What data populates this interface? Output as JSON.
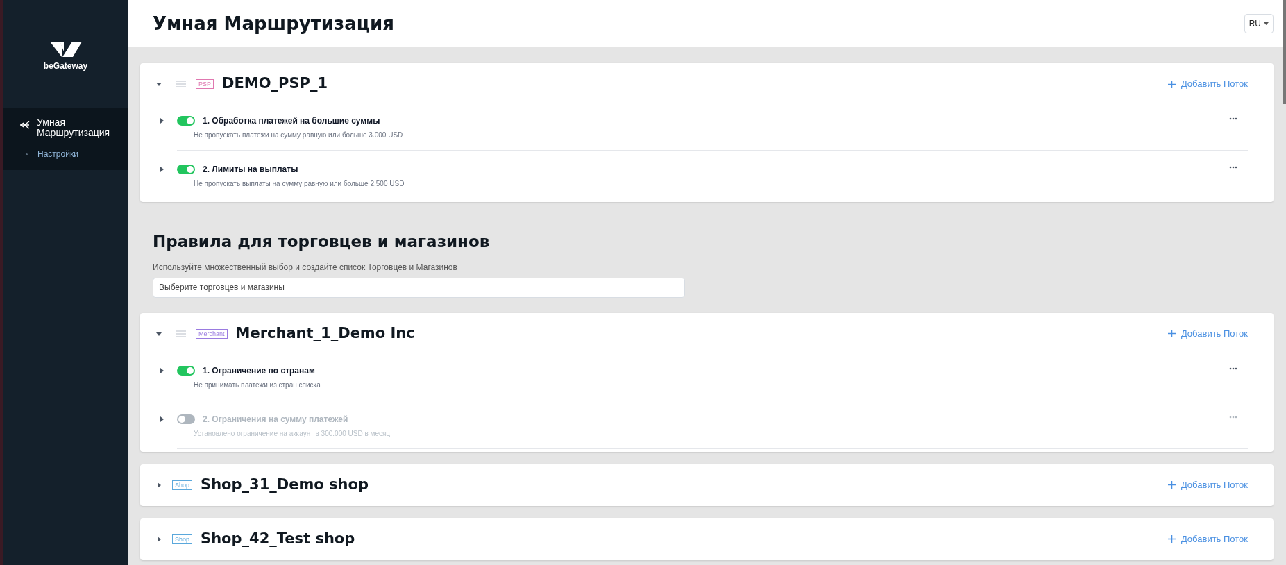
{
  "sidebar": {
    "logo_text": "beGateway",
    "items": [
      {
        "label": "Умная Маршрутизация",
        "selected": true,
        "children": [
          {
            "label": "Настройки",
            "selected": false
          }
        ]
      }
    ]
  },
  "header": {
    "title": "Умная Маршрутизация",
    "language": "RU"
  },
  "groups_top": [
    {
      "tag": "PSP",
      "color": "#e078b0",
      "title": "DEMO_PSP_1",
      "expanded": true,
      "add_label": "Добавить Поток",
      "rules": [
        {
          "title": "1. Обработка платежей на большие суммы",
          "description": "Не пропускать платежи на сумму равную или больше 3.000 USD",
          "on": true
        },
        {
          "title": "2. Лимиты на выплаты",
          "description": "Не пропускать выплаты на сумму равную или больше 2,500 USD",
          "on": true
        }
      ]
    }
  ],
  "section": {
    "title": "Правила для торговцев и магазинов",
    "description": "Используйте множественный выбор и создайте список Торговцев и Магазинов",
    "select_placeholder": "Выберите торговцев и магазины"
  },
  "groups": [
    {
      "tag": "Merchant",
      "color": "#9a7be0",
      "title": "Merchant_1_Demo Inc",
      "expanded": true,
      "add_label": "Добавить Поток",
      "rules": [
        {
          "title": "1. Ограничение по странам",
          "description": "Не принимать платежи из стран списка",
          "on": true
        },
        {
          "title": "2. Ограничения на сумму платежей",
          "description": "Установлено ограничение на аккаунт в 300.000 USD в месяц",
          "on": false
        }
      ]
    },
    {
      "tag": "Shop",
      "color": "#5aa8dc",
      "title": "Shop_31_Demo shop",
      "expanded": false,
      "add_label": "Добавить Поток"
    },
    {
      "tag": "Shop",
      "color": "#5aa8dc",
      "title": "Shop_42_Test shop",
      "expanded": false,
      "add_label": "Добавить Поток"
    }
  ]
}
